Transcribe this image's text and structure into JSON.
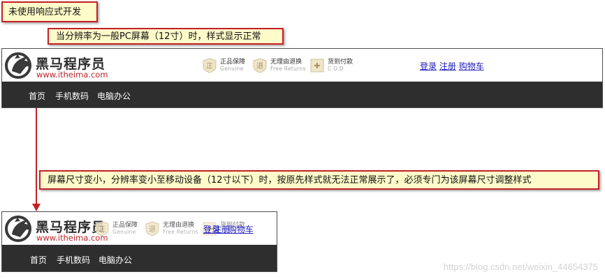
{
  "callouts": {
    "title": "未使用响应式开发",
    "normal": "当分辨率为一般PC屏幕（12寸）时，样式显示正常",
    "small": "屏幕尺寸变小，分辨率变小至移动设备（12寸以下）时，按原先样式就无法正常展示了，必须专门为该屏幕尺寸调整样式"
  },
  "site": {
    "logo_title": "黑马程序员",
    "logo_url": "www.itheima.com",
    "features": [
      {
        "cn": "正品保障",
        "en": "Genuine",
        "icon": "genuine-badge-icon",
        "glyph": "正"
      },
      {
        "cn": "无理由退换",
        "en": "Free Returns",
        "icon": "returns-badge-icon",
        "glyph": "退"
      },
      {
        "cn": "货到付款",
        "en": "C.O.D",
        "icon": "cod-badge-icon",
        "glyph": "✚"
      }
    ],
    "links": {
      "login": "登录",
      "register": "注册",
      "cart": "购物车"
    },
    "nav": [
      "首页",
      "手机数码",
      "电脑办公"
    ]
  },
  "colors": {
    "callout_bg": "#fdfbc9",
    "callout_border": "#c61f24",
    "nav_bg": "#2e2e2e",
    "link": "#1f1bbd",
    "url_red": "#b8242a",
    "arrow": "#c61f24"
  },
  "watermark": "https://blog.csdn.net/weixin_44654375"
}
